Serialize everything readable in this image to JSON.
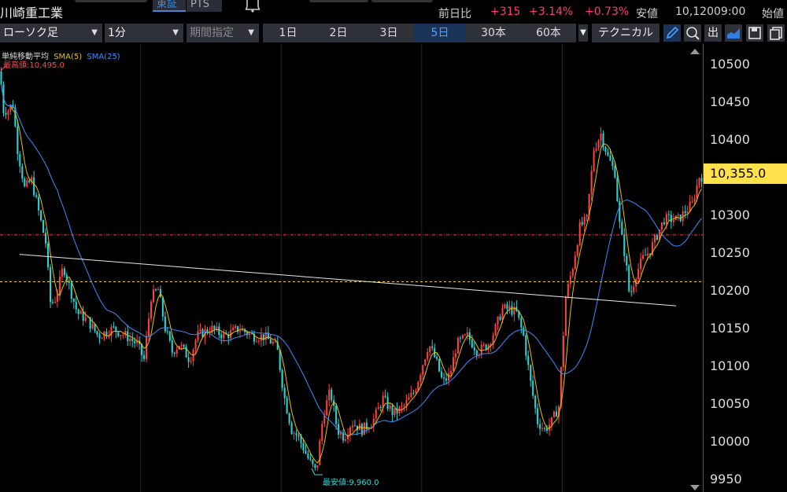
{
  "header": {
    "stock_name": "川崎重工業",
    "tabs": [
      "東証",
      "PTS"
    ],
    "change_label": "前日比",
    "change_value": "+315",
    "change_pct": "+3.14%",
    "extra_pct": "+0.73%",
    "low_label": "安値",
    "low_value": "10,120",
    "time": "09:00",
    "open_label": "始値"
  },
  "toolbar": {
    "chart_type": "ローソク足",
    "interval": "1分",
    "range_select": "期間指定",
    "periods": [
      "1日",
      "2日",
      "3日",
      "5日",
      "30本",
      "60本"
    ],
    "active_period": "5日",
    "technical": "テクニカル",
    "icons": [
      "pencil-icon",
      "zoom-icon",
      "volume-icon",
      "area-chart-icon",
      "save-icon",
      "copy-icon"
    ],
    "volume_glyph": "出"
  },
  "chart": {
    "legend": {
      "title": "単純移動平均",
      "sma5": "SMA(5)",
      "sma25": "SMA(25)"
    },
    "high_label": "最高値:10,495.0",
    "low_label": "最安値:9,960.0",
    "current_price": "10,355.0",
    "colors": {
      "up": "#ff4040",
      "down": "#2ad3d3",
      "sma5": "#e6c200",
      "sma25": "#3f8cff",
      "trendline": "#e8e8e8",
      "current": "#ffe14d",
      "prev_close": "#ff3d3d"
    },
    "y_ticks": [
      "10500",
      "10450",
      "10400",
      "10350",
      "10300",
      "10250",
      "10200",
      "10150",
      "10100",
      "10050",
      "10000",
      "9950"
    ]
  },
  "chart_data": {
    "type": "candlestick",
    "ylim": [
      9940,
      10515
    ],
    "reference_lines": {
      "prev_close_dashdot": 10270,
      "current_dashed": 10210
    },
    "trendline": {
      "from": [
        0.028,
        10245
      ],
      "to": [
        0.962,
        10179
      ]
    },
    "series": [
      {
        "name": "price_path",
        "points": [
          [
            0.0,
            10480
          ],
          [
            0.005,
            10430
          ],
          [
            0.012,
            10430
          ],
          [
            0.018,
            10440
          ],
          [
            0.025,
            10380
          ],
          [
            0.035,
            10330
          ],
          [
            0.045,
            10340
          ],
          [
            0.055,
            10300
          ],
          [
            0.065,
            10260
          ],
          [
            0.072,
            10180
          ],
          [
            0.08,
            10190
          ],
          [
            0.09,
            10230
          ],
          [
            0.1,
            10200
          ],
          [
            0.11,
            10170
          ],
          [
            0.125,
            10160
          ],
          [
            0.14,
            10140
          ],
          [
            0.16,
            10150
          ],
          [
            0.18,
            10140
          ],
          [
            0.195,
            10130
          ],
          [
            0.205,
            10110
          ],
          [
            0.215,
            10190
          ],
          [
            0.225,
            10200
          ],
          [
            0.235,
            10150
          ],
          [
            0.245,
            10120
          ],
          [
            0.255,
            10130
          ],
          [
            0.27,
            10110
          ],
          [
            0.28,
            10140
          ],
          [
            0.3,
            10150
          ],
          [
            0.32,
            10140
          ],
          [
            0.34,
            10150
          ],
          [
            0.36,
            10140
          ],
          [
            0.375,
            10140
          ],
          [
            0.39,
            10130
          ],
          [
            0.395,
            10120
          ],
          [
            0.405,
            10060
          ],
          [
            0.415,
            10020
          ],
          [
            0.425,
            10010
          ],
          [
            0.44,
            9980
          ],
          [
            0.45,
            9965
          ],
          [
            0.46,
            10040
          ],
          [
            0.47,
            10070
          ],
          [
            0.48,
            10020
          ],
          [
            0.49,
            10010
          ],
          [
            0.5,
            10030
          ],
          [
            0.515,
            10020
          ],
          [
            0.53,
            10030
          ],
          [
            0.545,
            10060
          ],
          [
            0.56,
            10040
          ],
          [
            0.575,
            10050
          ],
          [
            0.59,
            10070
          ],
          [
            0.6,
            10100
          ],
          [
            0.61,
            10130
          ],
          [
            0.62,
            10110
          ],
          [
            0.63,
            10080
          ],
          [
            0.64,
            10090
          ],
          [
            0.65,
            10130
          ],
          [
            0.665,
            10140
          ],
          [
            0.68,
            10120
          ],
          [
            0.695,
            10130
          ],
          [
            0.705,
            10150
          ],
          [
            0.715,
            10175
          ],
          [
            0.725,
            10175
          ],
          [
            0.735,
            10170
          ],
          [
            0.745,
            10140
          ],
          [
            0.755,
            10080
          ],
          [
            0.765,
            10030
          ],
          [
            0.775,
            10020
          ],
          [
            0.785,
            10030
          ],
          [
            0.795,
            10050
          ],
          [
            0.805,
            10190
          ],
          [
            0.815,
            10230
          ],
          [
            0.825,
            10280
          ],
          [
            0.835,
            10290
          ],
          [
            0.845,
            10380
          ],
          [
            0.855,
            10400
          ],
          [
            0.865,
            10370
          ],
          [
            0.875,
            10350
          ],
          [
            0.882,
            10280
          ],
          [
            0.89,
            10240
          ],
          [
            0.896,
            10190
          ],
          [
            0.905,
            10220
          ],
          [
            0.915,
            10240
          ],
          [
            0.925,
            10250
          ],
          [
            0.935,
            10270
          ],
          [
            0.945,
            10290
          ],
          [
            0.955,
            10290
          ],
          [
            0.965,
            10290
          ],
          [
            0.975,
            10300
          ],
          [
            0.985,
            10310
          ],
          [
            0.995,
            10345
          ]
        ]
      }
    ]
  }
}
